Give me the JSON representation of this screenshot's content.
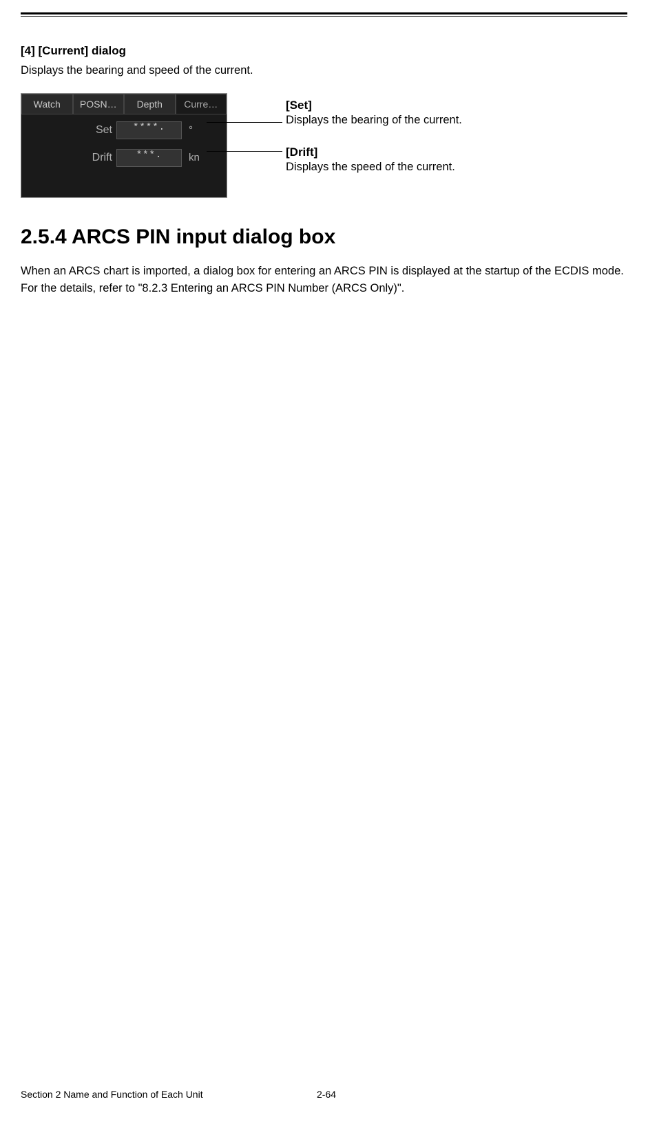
{
  "heading4": "[4] [Current] dialog",
  "heading4_desc": "Displays the bearing and speed of the current.",
  "dialog": {
    "tabs": [
      "Watch",
      "POSN…",
      "Depth",
      "Curre…"
    ],
    "set_label": "Set",
    "set_value": "****.",
    "set_unit": "°",
    "drift_label": "Drift",
    "drift_value": "***.",
    "drift_unit": "kn"
  },
  "annotations": {
    "set": {
      "title": "[Set]",
      "desc": "Displays the bearing of the current."
    },
    "drift": {
      "title": "[Drift]",
      "desc": "Displays the speed of the current."
    }
  },
  "h2": "2.5.4    ARCS PIN input dialog box",
  "para1": "When an ARCS chart is imported, a dialog box for entering an ARCS PIN is displayed at the startup of the ECDIS mode.",
  "para2": "For the details, refer to \"8.2.3 Entering an ARCS PIN Number (ARCS Only)\".",
  "footer": {
    "section": "Section 2    Name and Function of Each Unit",
    "page": "2-64"
  }
}
